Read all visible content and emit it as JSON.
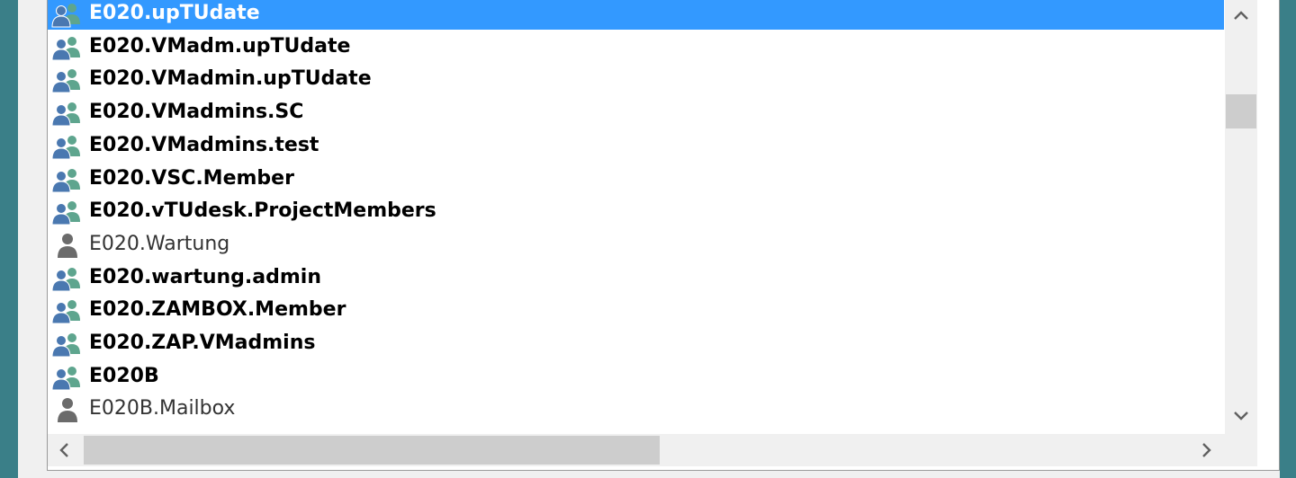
{
  "list": {
    "items": [
      {
        "label": "E020.upTUdate",
        "type": "group",
        "selected": true
      },
      {
        "label": "E020.VMadm.upTUdate",
        "type": "group"
      },
      {
        "label": "E020.VMadmin.upTUdate",
        "type": "group"
      },
      {
        "label": "E020.VMadmins.SC",
        "type": "group"
      },
      {
        "label": "E020.VMadmins.test",
        "type": "group"
      },
      {
        "label": "E020.VSC.Member",
        "type": "group"
      },
      {
        "label": "E020.vTUdesk.ProjectMembers",
        "type": "group"
      },
      {
        "label": "E020.Wartung",
        "type": "user"
      },
      {
        "label": "E020.wartung.admin",
        "type": "group"
      },
      {
        "label": "E020.ZAMBOX.Member",
        "type": "group"
      },
      {
        "label": "E020.ZAP.VMadmins",
        "type": "group"
      },
      {
        "label": "E020B",
        "type": "group"
      },
      {
        "label": "E020B.Mailbox",
        "type": "user"
      }
    ]
  },
  "icons": {
    "group": "group-users-icon",
    "user": "user-icon",
    "scroll_up": "chevron-up-icon",
    "scroll_down": "chevron-down-icon",
    "scroll_left": "chevron-left-icon",
    "scroll_right": "chevron-right-icon"
  },
  "colors": {
    "selection": "#3399ff",
    "group_icon_blue": "#4a78b0",
    "group_icon_green": "#5ea58e",
    "user_icon_gray": "#6b6b6b"
  }
}
